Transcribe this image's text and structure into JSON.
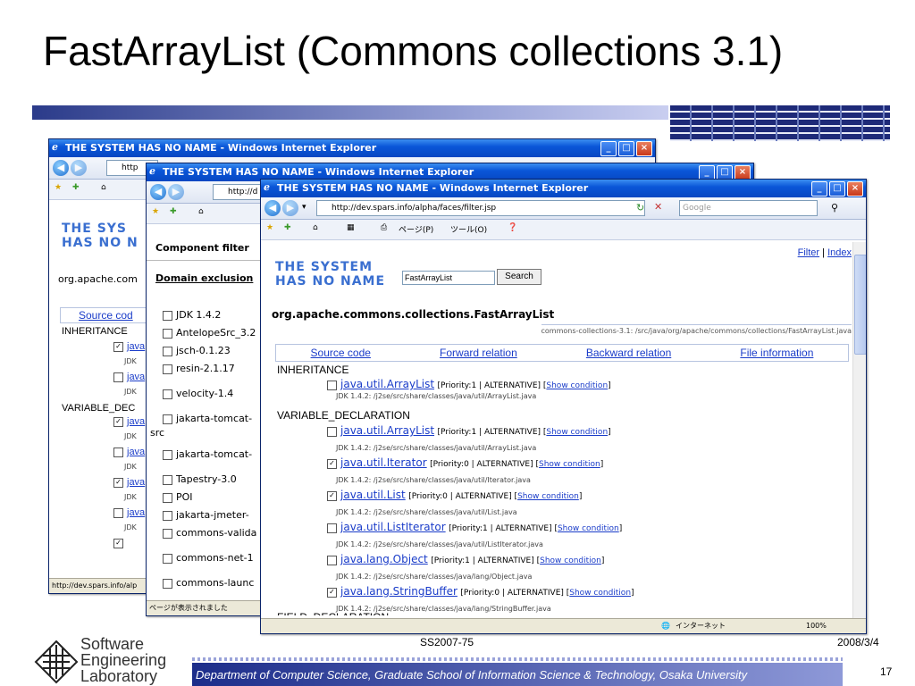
{
  "slide": {
    "title": "FastArrayList (Commons collections 3.1)",
    "footer_dept": "Department of Computer Science, Graduate School of Information Science & Technology, Osaka University",
    "footer_code": "SS2007-75",
    "footer_date": "2008/3/4",
    "page_number": "17",
    "lab_name_1": "Software",
    "lab_name_2": "Engineering",
    "lab_name_3": "Laboratory"
  },
  "window_back": {
    "title": "THE SYSTEM HAS NO NAME - Windows Internet Explorer",
    "addr": "http",
    "logo_1": "THE SYS",
    "logo_2": "HAS NO N",
    "pkg": "org.apache.com",
    "tab": "Source cod",
    "sections": [
      "INHERITANCE",
      "VARIABLE_DEC"
    ],
    "items": [
      "java",
      "java",
      "java",
      "java",
      "java",
      "java"
    ],
    "jdk": "JDK",
    "status": "http://dev.spars.info/alp"
  },
  "window_mid": {
    "title": "THE SYSTEM HAS NO NAME - Windows Internet Explorer",
    "addr": "http://d",
    "component_filter": "Component filter",
    "domain_exclusion": "Domain exclusion",
    "items": [
      "JDK 1.4.2",
      "AntelopeSrc_3.2",
      "jsch-0.1.23",
      "resin-2.1.17",
      "velocity-1.4",
      "jakarta-tomcat-",
      "src",
      "jakarta-tomcat-",
      "Tapestry-3.0",
      "POI",
      "jakarta-jmeter-",
      "commons-valida",
      "commons-net-1",
      "commons-launc"
    ],
    "status": "ページが表示されました"
  },
  "window_front": {
    "title": "THE SYSTEM HAS NO NAME - Windows Internet Explorer",
    "address": "http://dev.spars.info/alpha/faces/filter.jsp",
    "search_placeholder": "Google",
    "toolbar_page": "ページ(P)",
    "toolbar_tools": "ツール(O)",
    "top_links": {
      "filter": "Filter",
      "index": "Index"
    },
    "logo_1": "THE SYSTEM",
    "logo_2": "HAS NO NAME",
    "search_value": "FastArrayList",
    "search_button": "Search",
    "pkg": "org.apache.commons.collections.FastArrayList",
    "path": "commons-collections-3.1: /src/java/org/apache/commons/collections/FastArrayList.java",
    "tabs": [
      "Source code",
      "Forward relation",
      "Backward relation",
      "File information"
    ],
    "inheritance_label": "INHERITANCE",
    "variable_label": "VARIABLE_DECLARATION",
    "field_label": "FIELD_DECLARATION",
    "entries": [
      {
        "checked": false,
        "name": "java.util.ArrayList",
        "meta": "[Priority:1 | ALTERNATIVE] [",
        "cond": "Show condition",
        "end": "]",
        "jdk": "JDK 1.4.2: /j2se/src/share/classes/java/util/ArrayList.java"
      },
      {
        "checked": false,
        "name": "java.util.ArrayList",
        "meta": "[Priority:1 | ALTERNATIVE] [",
        "cond": "Show condition",
        "end": "]",
        "jdk": "JDK 1.4.2: /j2se/src/share/classes/java/util/ArrayList.java"
      },
      {
        "checked": true,
        "name": "java.util.Iterator",
        "meta": "[Priority:0 | ALTERNATIVE] [",
        "cond": "Show condition",
        "end": "]",
        "jdk": "JDK 1.4.2: /j2se/src/share/classes/java/util/Iterator.java"
      },
      {
        "checked": true,
        "name": "java.util.List",
        "meta": "[Priority:0 | ALTERNATIVE] [",
        "cond": "Show condition",
        "end": "]",
        "jdk": "JDK 1.4.2: /j2se/src/share/classes/java/util/List.java"
      },
      {
        "checked": false,
        "name": "java.util.ListIterator",
        "meta": "[Priority:1 | ALTERNATIVE] [",
        "cond": "Show condition",
        "end": "]",
        "jdk": "JDK 1.4.2: /j2se/src/share/classes/java/util/ListIterator.java"
      },
      {
        "checked": false,
        "name": "java.lang.Object",
        "meta": "[Priority:1 | ALTERNATIVE] [",
        "cond": "Show condition",
        "end": "]",
        "jdk": "JDK 1.4.2: /j2se/src/share/classes/java/lang/Object.java"
      },
      {
        "checked": true,
        "name": "java.lang.StringBuffer",
        "meta": "[Priority:0 | ALTERNATIVE] [",
        "cond": "Show condition",
        "end": "]",
        "jdk": "JDK 1.4.2: /j2se/src/share/classes/java/lang/StringBuffer.java"
      }
    ],
    "status_zone": "インターネット",
    "status_zoom": "100%"
  }
}
